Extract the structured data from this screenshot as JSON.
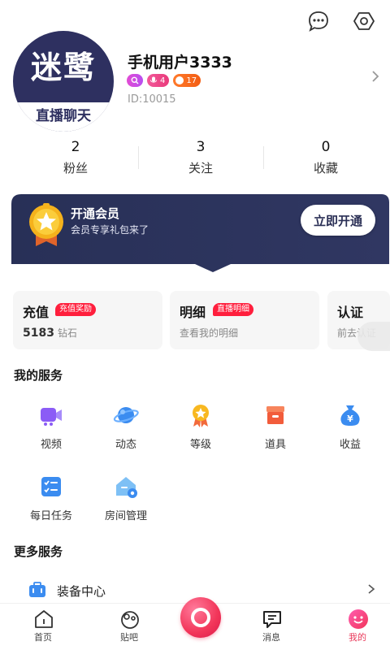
{
  "profile": {
    "avatar_text_top": "迷鹭",
    "avatar_text_bottom": "直播聊天",
    "username": "手机用户3333",
    "badge_2_value": "4",
    "badge_3_value": "17",
    "uid": "ID:10015"
  },
  "stats": [
    {
      "value": "2",
      "label": "粉丝"
    },
    {
      "value": "3",
      "label": "关注"
    },
    {
      "value": "0",
      "label": "收藏"
    }
  ],
  "vip": {
    "title": "开通会员",
    "subtitle": "会员专享礼包来了",
    "button": "立即开通"
  },
  "cards": [
    {
      "title": "充值",
      "tag": "充值奖励",
      "value": "5183",
      "unit": "钻石"
    },
    {
      "title": "明细",
      "tag": "直播明细",
      "sub": "查看我的明细"
    },
    {
      "title": "认证",
      "sub": "前去认证"
    }
  ],
  "my_services": {
    "title": "我的服务",
    "items": [
      {
        "label": "视频",
        "icon": "video-camera-icon"
      },
      {
        "label": "动态",
        "icon": "planet-icon"
      },
      {
        "label": "等级",
        "icon": "medal-icon"
      },
      {
        "label": "道具",
        "icon": "box-icon"
      },
      {
        "label": "收益",
        "icon": "money-bag-icon"
      },
      {
        "label": "每日任务",
        "icon": "checklist-icon"
      },
      {
        "label": "房间管理",
        "icon": "house-settings-icon"
      }
    ]
  },
  "more_services": {
    "title": "更多服务",
    "equip_label": "装备中心"
  },
  "tabbar": [
    {
      "label": "首页",
      "icon": "home-icon"
    },
    {
      "label": "贴吧",
      "icon": "community-icon"
    },
    {
      "label": "消息",
      "icon": "message-icon"
    },
    {
      "label": "我的",
      "icon": "me-icon"
    }
  ],
  "colors": {
    "accent": "#e93a5b",
    "vip_banner": "#2c3258",
    "tag_red": "#ff1f3d"
  }
}
